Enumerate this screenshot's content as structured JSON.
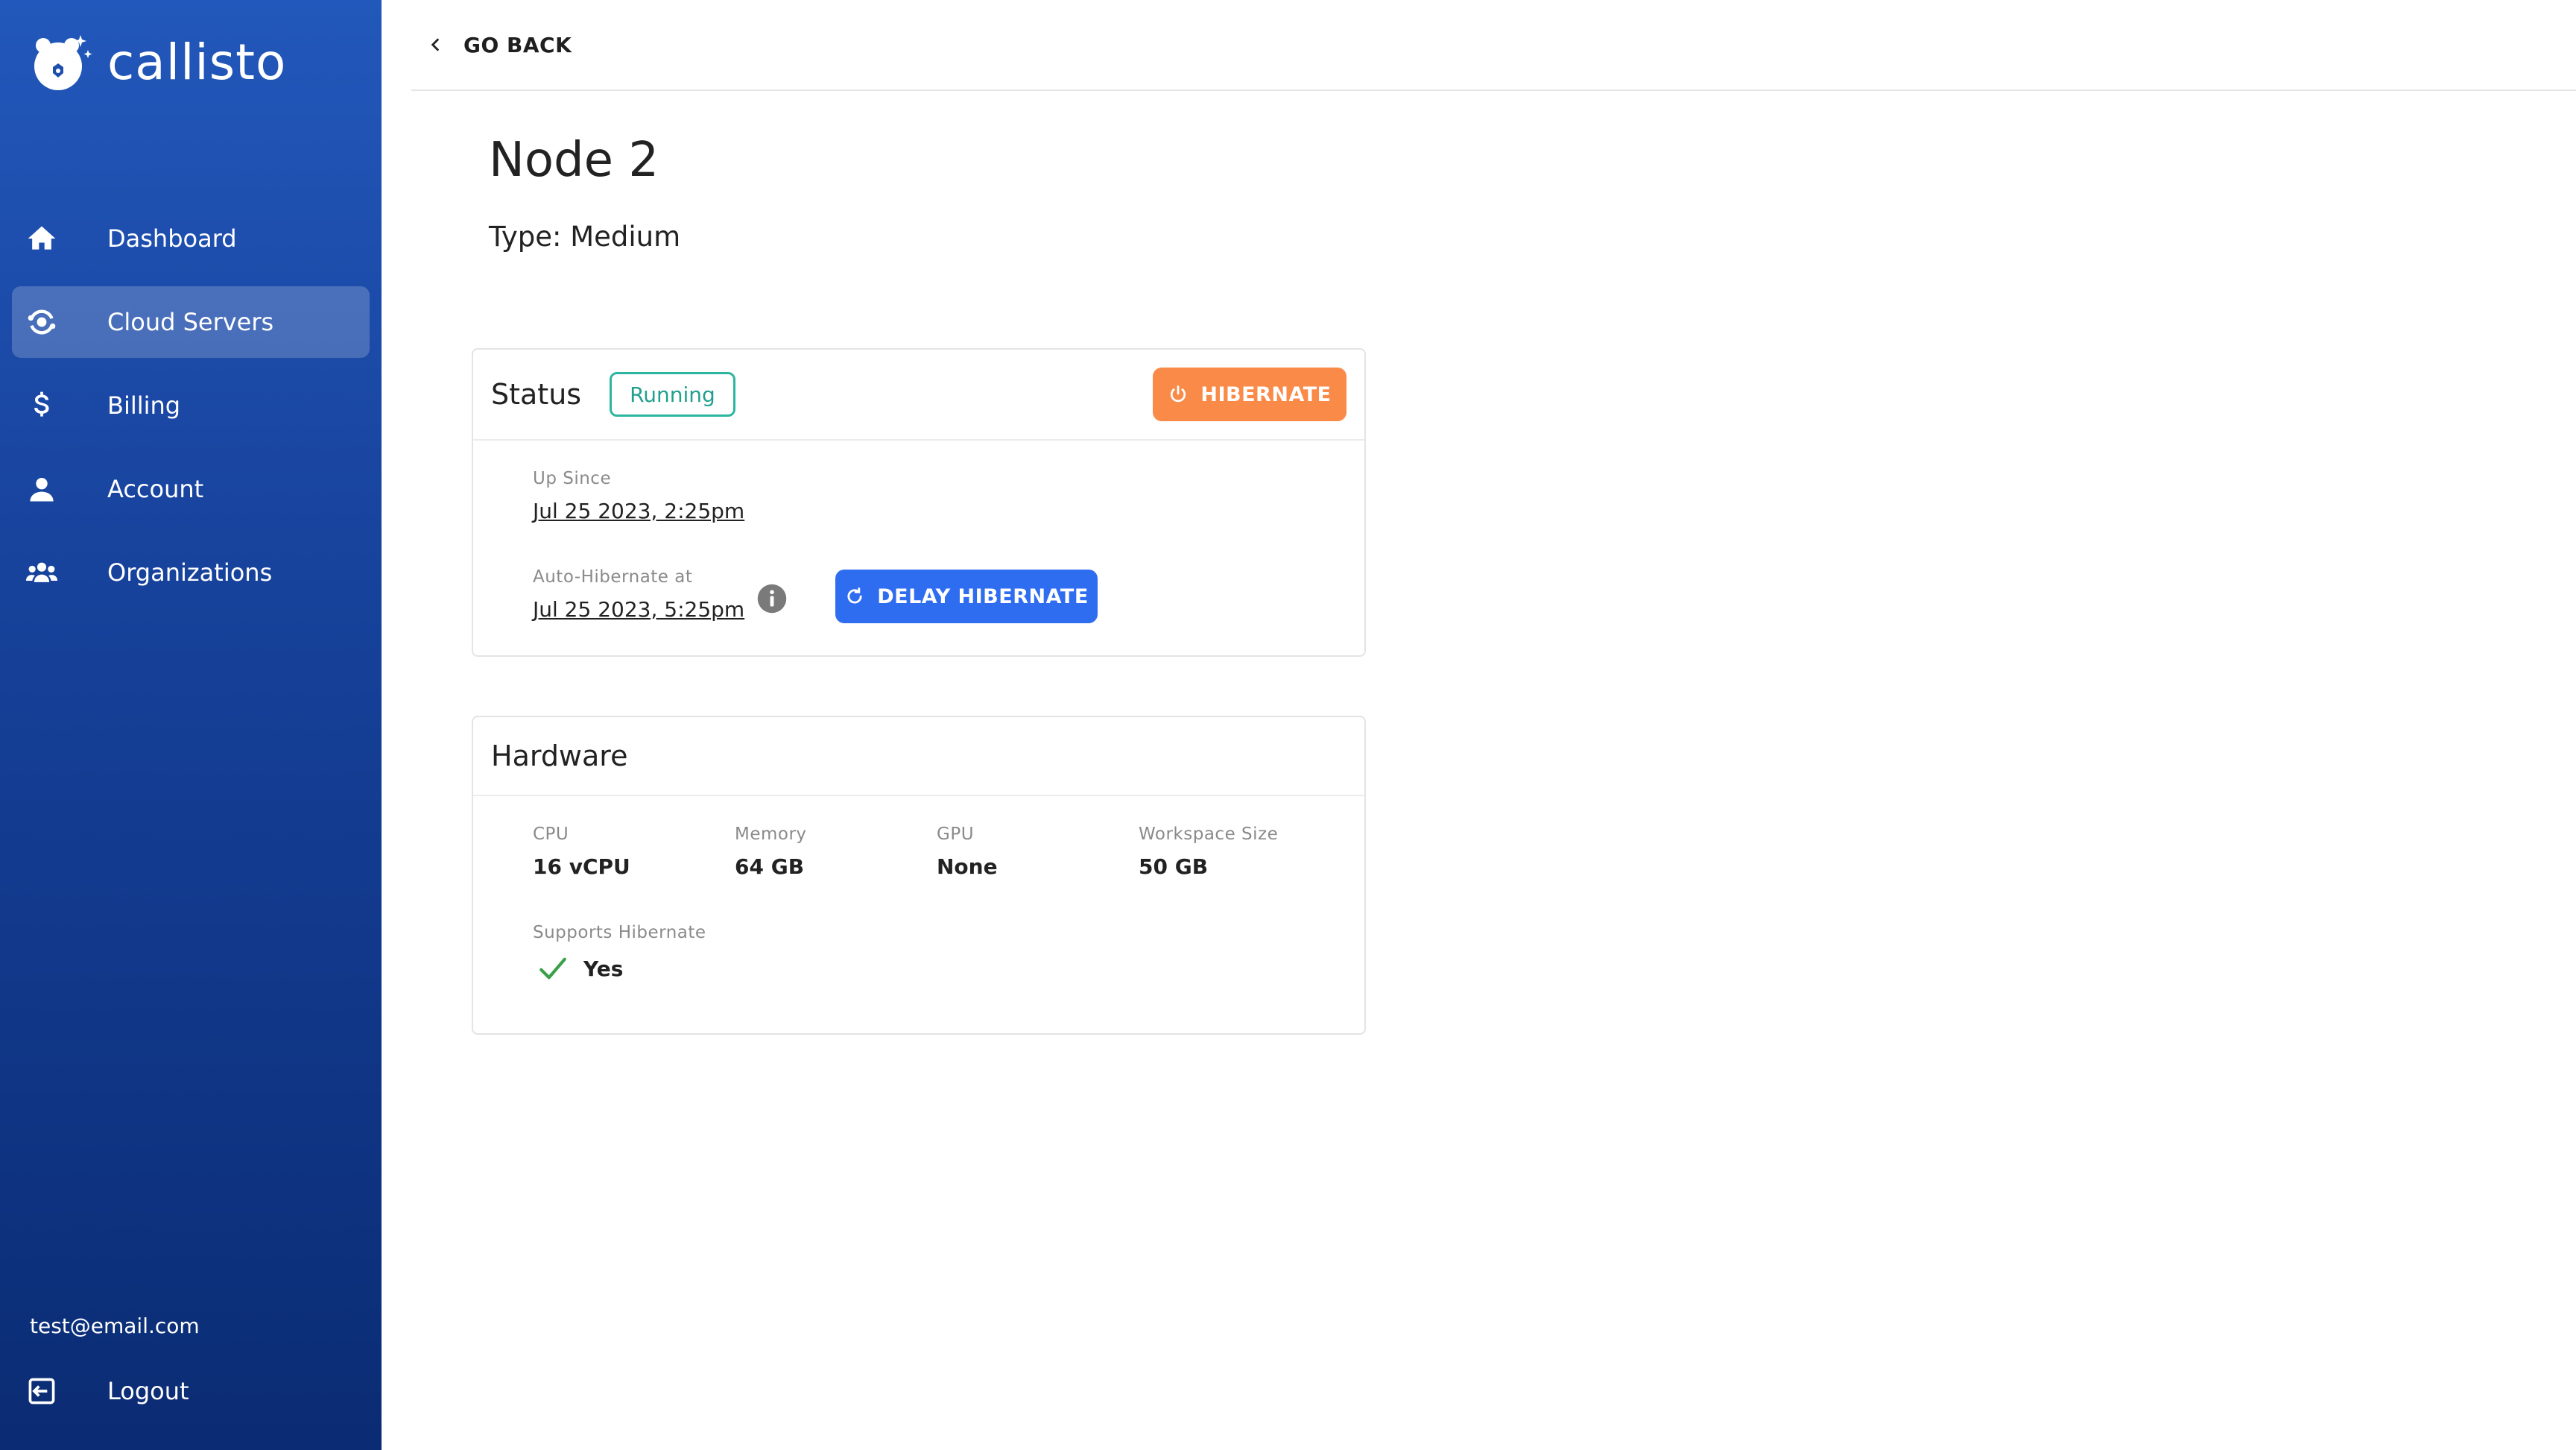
{
  "brand": {
    "name": "callisto"
  },
  "sidebar": {
    "items": [
      {
        "label": "Dashboard",
        "icon": "home-icon",
        "active": false
      },
      {
        "label": "Cloud Servers",
        "icon": "cloud-servers-icon",
        "active": true
      },
      {
        "label": "Billing",
        "icon": "dollar-icon",
        "active": false
      },
      {
        "label": "Account",
        "icon": "user-icon",
        "active": false
      },
      {
        "label": "Organizations",
        "icon": "group-icon",
        "active": false
      }
    ],
    "user_email": "test@email.com",
    "logout_label": "Logout"
  },
  "topbar": {
    "back_label": "GO BACK"
  },
  "node": {
    "title": "Node 2",
    "type_line": "Type: Medium"
  },
  "status_card": {
    "title": "Status",
    "badge": "Running",
    "hibernate_label": "HIBERNATE",
    "up_since_label": "Up Since",
    "up_since_value": "Jul 25 2023, 2:25pm",
    "auto_hibernate_label": "Auto-Hibernate at",
    "auto_hibernate_value": "Jul 25 2023, 5:25pm",
    "delay_label": "DELAY HIBERNATE"
  },
  "hardware_card": {
    "title": "Hardware",
    "specs": [
      {
        "label": "CPU",
        "value": "16 vCPU"
      },
      {
        "label": "Memory",
        "value": "64 GB"
      },
      {
        "label": "GPU",
        "value": "None"
      },
      {
        "label": "Workspace Size",
        "value": "50 GB"
      }
    ],
    "hibernate_support_label": "Supports Hibernate",
    "hibernate_support_value": "Yes"
  },
  "colors": {
    "sidebar_top": "#2258bb",
    "sidebar_bottom": "#0b2c74",
    "running": "#2eb5a0",
    "hibernate": "#f98a47",
    "delay": "#2f6df0",
    "check": "#3aa04a"
  }
}
